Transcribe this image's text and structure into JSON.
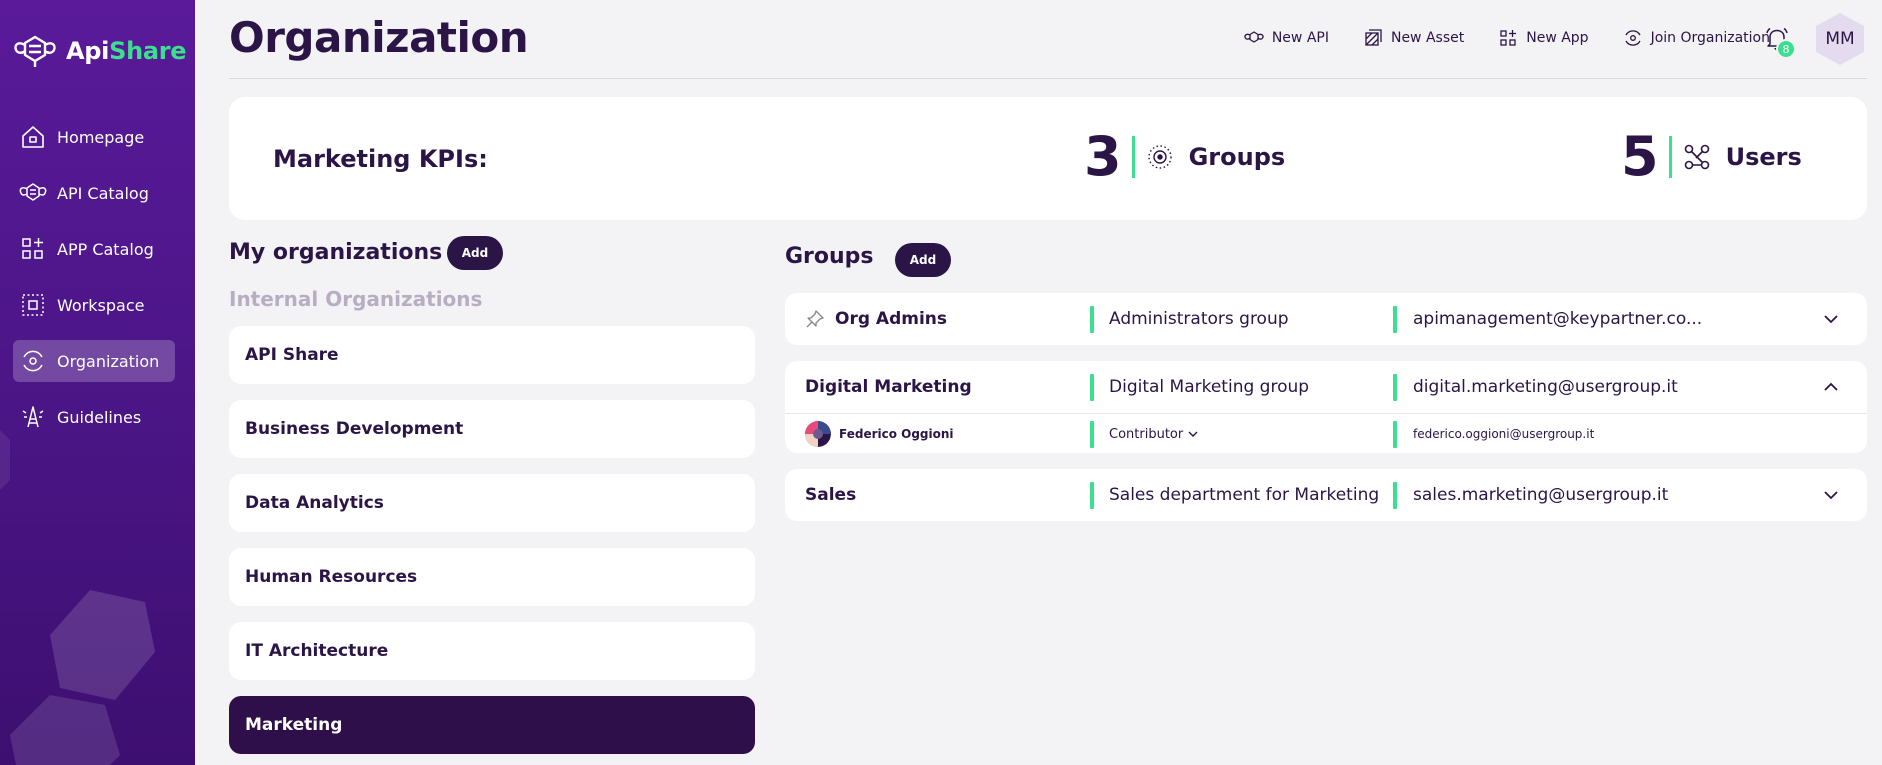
{
  "brand": {
    "name_part1": "Api",
    "name_part2": "Share",
    "accent_color": "#3be08e"
  },
  "sidebar": {
    "items": [
      {
        "label": "Homepage",
        "icon": "home-icon"
      },
      {
        "label": "API Catalog",
        "icon": "api-icon"
      },
      {
        "label": "APP Catalog",
        "icon": "apps-icon"
      },
      {
        "label": "Workspace",
        "icon": "workspace-icon"
      },
      {
        "label": "Organization",
        "icon": "organization-icon",
        "active": true
      },
      {
        "label": "Guidelines",
        "icon": "guidelines-icon"
      }
    ]
  },
  "header": {
    "title": "Organization",
    "actions": [
      {
        "label": "New API",
        "icon": "api-icon"
      },
      {
        "label": "New Asset",
        "icon": "asset-icon"
      },
      {
        "label": "New App",
        "icon": "app-icon"
      },
      {
        "label": "Join Organization",
        "icon": "join-icon"
      }
    ],
    "notifications_count": "8",
    "user_initials": "MM"
  },
  "kpi": {
    "label": "Marketing KPIs:",
    "groups_count": "3",
    "groups_label": "Groups",
    "users_count": "5",
    "users_label": "Users"
  },
  "organizations": {
    "title": "My organizations",
    "add_label": "Add",
    "section_title": "Internal Organizations",
    "items": [
      {
        "name": "API Share"
      },
      {
        "name": "Business Development"
      },
      {
        "name": "Data Analytics"
      },
      {
        "name": "Human Resources"
      },
      {
        "name": "IT Architecture"
      },
      {
        "name": "Marketing",
        "selected": true
      }
    ]
  },
  "groups": {
    "title": "Groups",
    "add_label": "Add",
    "items": [
      {
        "name": "Org Admins",
        "description": "Administrators group",
        "email": "apimanagement@keypartner.co...",
        "expanded": false
      },
      {
        "name": "Digital Marketing",
        "description": "Digital Marketing group",
        "email": "digital.marketing@usergroup.it",
        "expanded": true,
        "members": [
          {
            "name": "Federico Oggioni",
            "role": "Contributor",
            "email": "federico.oggioni@usergroup.it"
          }
        ]
      },
      {
        "name": "Sales",
        "description": "Sales department for Marketing ...",
        "email": "sales.marketing@usergroup.it",
        "expanded": false
      }
    ]
  }
}
